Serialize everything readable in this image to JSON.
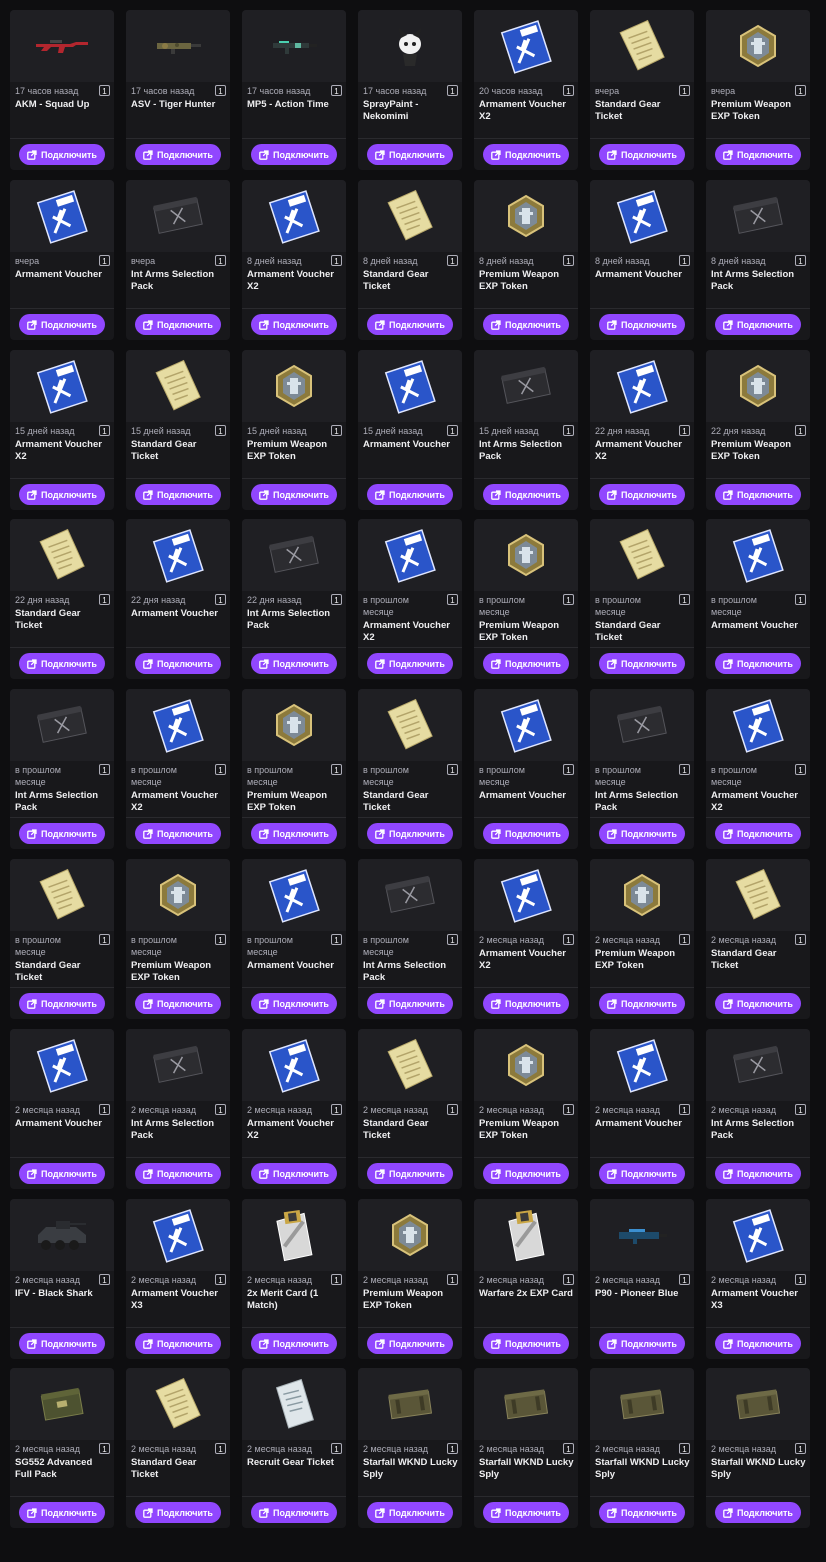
{
  "button_label": "Подключить",
  "accent": "#9147ff",
  "items": [
    {
      "time": "17 часов назад",
      "qty": "1",
      "name": "AKM - Squad Up",
      "icon": "rifle-red-icon"
    },
    {
      "time": "17 часов назад",
      "qty": "1",
      "name": "ASV - Tiger Hunter",
      "icon": "rifle-camo-icon"
    },
    {
      "time": "17 часов назад",
      "qty": "1",
      "name": "MP5 - Action Time",
      "icon": "smg-icon"
    },
    {
      "time": "17 часов назад",
      "qty": "1",
      "name": "SprayPaint - Nekomimi",
      "icon": "spray-cat-icon"
    },
    {
      "time": "20 часов назад",
      "qty": "1",
      "name": "Armament Voucher X2",
      "icon": "voucher-icon"
    },
    {
      "time": "вчера",
      "qty": "1",
      "name": "Standard Gear Ticket",
      "icon": "gear-ticket-icon"
    },
    {
      "time": "вчера",
      "qty": "1",
      "name": "Premium Weapon EXP Token",
      "icon": "exp-token-icon"
    },
    {
      "time": "вчера",
      "qty": "1",
      "name": "Armament Voucher",
      "icon": "voucher-icon"
    },
    {
      "time": "вчера",
      "qty": "1",
      "name": "Int Arms Selection Pack",
      "icon": "arms-case-icon"
    },
    {
      "time": "8 дней назад",
      "qty": "1",
      "name": "Armament Voucher X2",
      "icon": "voucher-icon"
    },
    {
      "time": "8 дней назад",
      "qty": "1",
      "name": "Standard Gear Ticket",
      "icon": "gear-ticket-icon"
    },
    {
      "time": "8 дней назад",
      "qty": "1",
      "name": "Premium Weapon EXP Token",
      "icon": "exp-token-icon"
    },
    {
      "time": "8 дней назад",
      "qty": "1",
      "name": "Armament Voucher",
      "icon": "voucher-icon"
    },
    {
      "time": "8 дней назад",
      "qty": "1",
      "name": "Int Arms Selection Pack",
      "icon": "arms-case-icon"
    },
    {
      "time": "15 дней назад",
      "qty": "1",
      "name": "Armament Voucher X2",
      "icon": "voucher-icon"
    },
    {
      "time": "15 дней назад",
      "qty": "1",
      "name": "Standard Gear Ticket",
      "icon": "gear-ticket-icon"
    },
    {
      "time": "15 дней назад",
      "qty": "1",
      "name": "Premium Weapon EXP Token",
      "icon": "exp-token-icon"
    },
    {
      "time": "15 дней назад",
      "qty": "1",
      "name": "Armament Voucher",
      "icon": "voucher-icon"
    },
    {
      "time": "15 дней назад",
      "qty": "1",
      "name": "Int Arms Selection Pack",
      "icon": "arms-case-icon"
    },
    {
      "time": "22 дня назад",
      "qty": "1",
      "name": "Armament Voucher X2",
      "icon": "voucher-icon"
    },
    {
      "time": "22 дня назад",
      "qty": "1",
      "name": "Premium Weapon EXP Token",
      "icon": "exp-token-icon"
    },
    {
      "time": "22 дня назад",
      "qty": "1",
      "name": "Standard Gear Ticket",
      "icon": "gear-ticket-icon"
    },
    {
      "time": "22 дня назад",
      "qty": "1",
      "name": "Armament Voucher",
      "icon": "voucher-icon"
    },
    {
      "time": "22 дня назад",
      "qty": "1",
      "name": "Int Arms Selection Pack",
      "icon": "arms-case-icon"
    },
    {
      "time": "в прошлом месяце",
      "qty": "1",
      "name": "Armament Voucher X2",
      "icon": "voucher-icon"
    },
    {
      "time": "в прошлом месяце",
      "qty": "1",
      "name": "Premium Weapon EXP Token",
      "icon": "exp-token-icon"
    },
    {
      "time": "в прошлом месяце",
      "qty": "1",
      "name": "Standard Gear Ticket",
      "icon": "gear-ticket-icon"
    },
    {
      "time": "в прошлом месяце",
      "qty": "1",
      "name": "Armament Voucher",
      "icon": "voucher-icon"
    },
    {
      "time": "в прошлом месяце",
      "qty": "1",
      "name": "Int Arms Selection Pack",
      "icon": "arms-case-icon"
    },
    {
      "time": "в прошлом месяце",
      "qty": "1",
      "name": "Armament Voucher X2",
      "icon": "voucher-icon"
    },
    {
      "time": "в прошлом месяце",
      "qty": "1",
      "name": "Premium Weapon EXP Token",
      "icon": "exp-token-icon"
    },
    {
      "time": "в прошлом месяце",
      "qty": "1",
      "name": "Standard Gear Ticket",
      "icon": "gear-ticket-icon"
    },
    {
      "time": "в прошлом месяце",
      "qty": "1",
      "name": "Armament Voucher",
      "icon": "voucher-icon"
    },
    {
      "time": "в прошлом месяце",
      "qty": "1",
      "name": "Int Arms Selection Pack",
      "icon": "arms-case-icon"
    },
    {
      "time": "в прошлом месяце",
      "qty": "1",
      "name": "Armament Voucher X2",
      "icon": "voucher-icon"
    },
    {
      "time": "в прошлом месяце",
      "qty": "1",
      "name": "Standard Gear Ticket",
      "icon": "gear-ticket-icon"
    },
    {
      "time": "в прошлом месяце",
      "qty": "1",
      "name": "Premium Weapon EXP Token",
      "icon": "exp-token-icon"
    },
    {
      "time": "в прошлом месяце",
      "qty": "1",
      "name": "Armament Voucher",
      "icon": "voucher-icon"
    },
    {
      "time": "в прошлом месяце",
      "qty": "1",
      "name": "Int Arms Selection Pack",
      "icon": "arms-case-icon"
    },
    {
      "time": "2 месяца назад",
      "qty": "1",
      "name": "Armament Voucher X2",
      "icon": "voucher-icon"
    },
    {
      "time": "2 месяца назад",
      "qty": "1",
      "name": "Premium Weapon EXP Token",
      "icon": "exp-token-icon"
    },
    {
      "time": "2 месяца назад",
      "qty": "1",
      "name": "Standard Gear Ticket",
      "icon": "gear-ticket-icon"
    },
    {
      "time": "2 месяца назад",
      "qty": "1",
      "name": "Armament Voucher",
      "icon": "voucher-icon"
    },
    {
      "time": "2 месяца назад",
      "qty": "1",
      "name": "Int Arms Selection Pack",
      "icon": "arms-case-icon"
    },
    {
      "time": "2 месяца назад",
      "qty": "1",
      "name": "Armament Voucher X2",
      "icon": "voucher-icon"
    },
    {
      "time": "2 месяца назад",
      "qty": "1",
      "name": "Standard Gear Ticket",
      "icon": "gear-ticket-icon"
    },
    {
      "time": "2 месяца назад",
      "qty": "1",
      "name": "Premium Weapon EXP Token",
      "icon": "exp-token-icon"
    },
    {
      "time": "2 месяца назад",
      "qty": "1",
      "name": "Armament Voucher",
      "icon": "voucher-icon"
    },
    {
      "time": "2 месяца назад",
      "qty": "1",
      "name": "Int Arms Selection Pack",
      "icon": "arms-case-icon"
    },
    {
      "time": "2 месяца назад",
      "qty": "1",
      "name": "IFV - Black Shark",
      "icon": "ifv-vehicle-icon"
    },
    {
      "time": "2 месяца назад",
      "qty": "1",
      "name": "Armament Voucher X3",
      "icon": "voucher-icon"
    },
    {
      "time": "2 месяца назад",
      "qty": "1",
      "name": "2x Merit Card (1 Match)",
      "icon": "merit-card-icon"
    },
    {
      "time": "2 месяца назад",
      "qty": "1",
      "name": "Premium Weapon EXP Token",
      "icon": "exp-token-icon"
    },
    {
      "time": "2 месяца назад",
      "qty": "1",
      "name": "Warfare 2x EXP Card",
      "icon": "merit-card-icon"
    },
    {
      "time": "2 месяца назад",
      "qty": "1",
      "name": "P90 - Pioneer Blue",
      "icon": "p90-blue-icon"
    },
    {
      "time": "2 месяца назад",
      "qty": "1",
      "name": "Armament Voucher X3",
      "icon": "voucher-icon"
    },
    {
      "time": "2 месяца назад",
      "qty": "1",
      "name": "SG552 Advanced Full Pack",
      "icon": "supply-crate-icon"
    },
    {
      "time": "2 месяца назад",
      "qty": "1",
      "name": "Standard Gear Ticket",
      "icon": "gear-ticket-icon"
    },
    {
      "time": "2 месяца назад",
      "qty": "1",
      "name": "Recruit Gear Ticket",
      "icon": "recruit-ticket-icon"
    },
    {
      "time": "2 месяца назад",
      "qty": "1",
      "name": "Starfall WKND Lucky Sply",
      "icon": "lucky-crate-icon"
    },
    {
      "time": "2 месяца назад",
      "qty": "1",
      "name": "Starfall WKND Lucky Sply",
      "icon": "lucky-crate-icon"
    },
    {
      "time": "2 месяца назад",
      "qty": "1",
      "name": "Starfall WKND Lucky Sply",
      "icon": "lucky-crate-icon"
    },
    {
      "time": "2 месяца назад",
      "qty": "1",
      "name": "Starfall WKND Lucky Sply",
      "icon": "lucky-crate-icon"
    }
  ]
}
